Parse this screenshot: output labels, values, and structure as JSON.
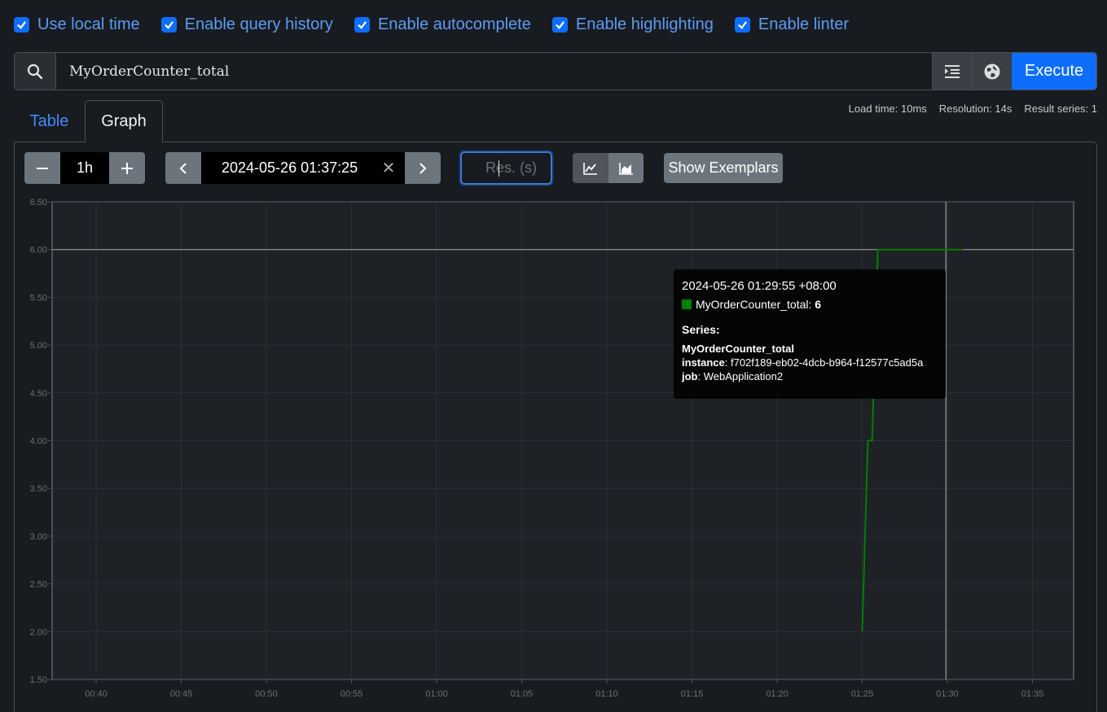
{
  "options": [
    {
      "label": "Use local time",
      "checked": true
    },
    {
      "label": "Enable query history",
      "checked": true
    },
    {
      "label": "Enable autocomplete",
      "checked": true
    },
    {
      "label": "Enable highlighting",
      "checked": true
    },
    {
      "label": "Enable linter",
      "checked": true
    }
  ],
  "query": {
    "expression": "MyOrderCounter_total",
    "execute_label": "Execute"
  },
  "tabs": {
    "table": "Table",
    "graph": "Graph",
    "active": "Graph"
  },
  "stats": {
    "load_time": "Load time: 10ms",
    "resolution": "Resolution: 14s",
    "result_series": "Result series: 1"
  },
  "controls": {
    "range": "1h",
    "end_time": "2024-05-26 01:37:25",
    "res_placeholder": "Res. (s)",
    "exemplars_label": "Show Exemplars"
  },
  "tooltip": {
    "time": "2024-05-26 01:29:55 +08:00",
    "series_name": "MyOrderCounter_total",
    "value": "6",
    "series_heading": "Series:",
    "metric": "MyOrderCounter_total",
    "instance_key": "instance",
    "instance_val": "f702f189-eb02-4dcb-b964-f12577c5ad5a",
    "job_key": "job",
    "job_val": "WebApplication2"
  },
  "colors": {
    "series": "#008000",
    "accent": "#0d6efd"
  },
  "chart_data": {
    "type": "line",
    "y_ticks": [
      "1.50",
      "2.00",
      "2.50",
      "3.00",
      "3.50",
      "4.00",
      "4.50",
      "5.00",
      "5.50",
      "6.00",
      "6.50"
    ],
    "ylim": [
      1.5,
      6.5
    ],
    "x_ticks": [
      "00:40",
      "00:45",
      "00:50",
      "00:55",
      "01:00",
      "01:05",
      "01:10",
      "01:15",
      "01:20",
      "01:25",
      "01:30",
      "01:35"
    ],
    "xlim": [
      "00:37:25",
      "01:37:25"
    ],
    "series": [
      {
        "name": "MyOrderCounter_total",
        "color": "#008000",
        "points": [
          [
            "01:25:00",
            2
          ],
          [
            "01:25:20",
            4
          ],
          [
            "01:25:35",
            4
          ],
          [
            "01:25:55",
            6
          ],
          [
            "01:29:55",
            6
          ],
          [
            "01:30:55",
            6
          ]
        ]
      }
    ],
    "hover_time": "01:29:55",
    "hover_value": 6
  }
}
